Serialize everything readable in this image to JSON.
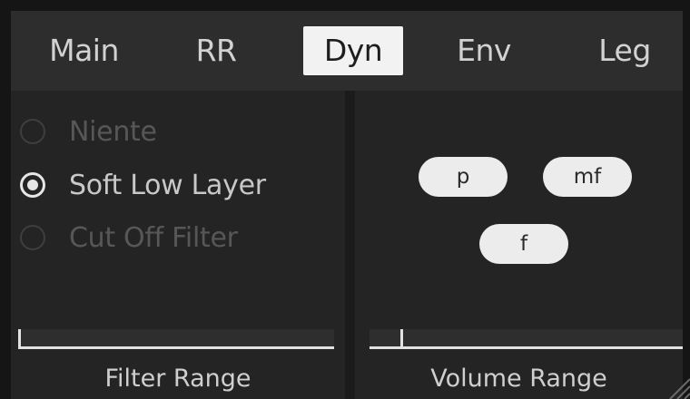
{
  "tabs": [
    {
      "label": "Main",
      "active": false
    },
    {
      "label": "RR",
      "active": false
    },
    {
      "label": "Dyn",
      "active": true
    },
    {
      "label": "Env",
      "active": false
    },
    {
      "label": "Leg",
      "active": false
    }
  ],
  "filter_panel": {
    "options": [
      {
        "label": "Niente",
        "selected": false
      },
      {
        "label": "Soft Low Layer",
        "selected": true
      },
      {
        "label": "Cut Off Filter",
        "selected": false
      }
    ],
    "range_label": "Filter Range"
  },
  "volume_panel": {
    "dynamics": [
      {
        "label": "p"
      },
      {
        "label": "mf"
      },
      {
        "label": "f"
      }
    ],
    "range_label": "Volume Range"
  },
  "colors": {
    "background": "#151515",
    "tabbar": "#2d2d2d",
    "panel": "#242424",
    "active_tab": "#f2f2f2",
    "text": "#d2d2d2",
    "disabled_text": "#575757"
  }
}
